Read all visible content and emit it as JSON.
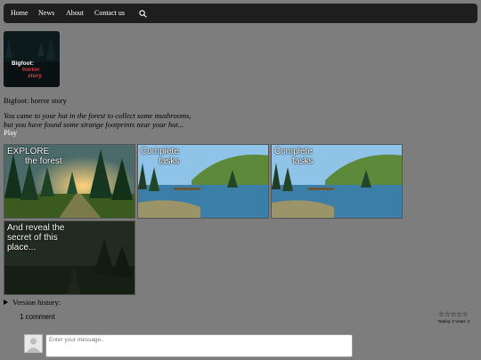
{
  "nav": {
    "items": [
      {
        "label": "Home"
      },
      {
        "label": "News"
      },
      {
        "label": "About"
      },
      {
        "label": "Contact us"
      }
    ],
    "search_icon": "search-icon"
  },
  "game": {
    "cover_line1": "Bigfoot:",
    "cover_line2": "horror",
    "cover_line3": "story",
    "title": "Bigfoot: horror story",
    "desc_line1": "You came to your hut in the forest to collect some mushrooms,",
    "desc_line2": "but you have found some strange footprints near your hut...",
    "play_label": "Play"
  },
  "screenshots": [
    {
      "cap1": "EXPLORE",
      "cap2": "the forest"
    },
    {
      "cap1": "Complete",
      "cap2": "tasks"
    },
    {
      "cap1": "Complete",
      "cap2": "tasks"
    },
    {
      "cap1": "And reveal the",
      "cap2": "secret of this",
      "cap3": "place..."
    }
  ],
  "version_history": {
    "label": "Version history:"
  },
  "comments": {
    "count_label": "1 comment",
    "stars": "☆☆☆☆☆",
    "rating_info": "Rating: 0 Votes: 2",
    "input_placeholder": "Enter your message.."
  },
  "colors": {
    "page_bg": "#7d7d7d",
    "navbar_bg": "#1e1e1e",
    "cover_accent": "#e23b3b"
  }
}
